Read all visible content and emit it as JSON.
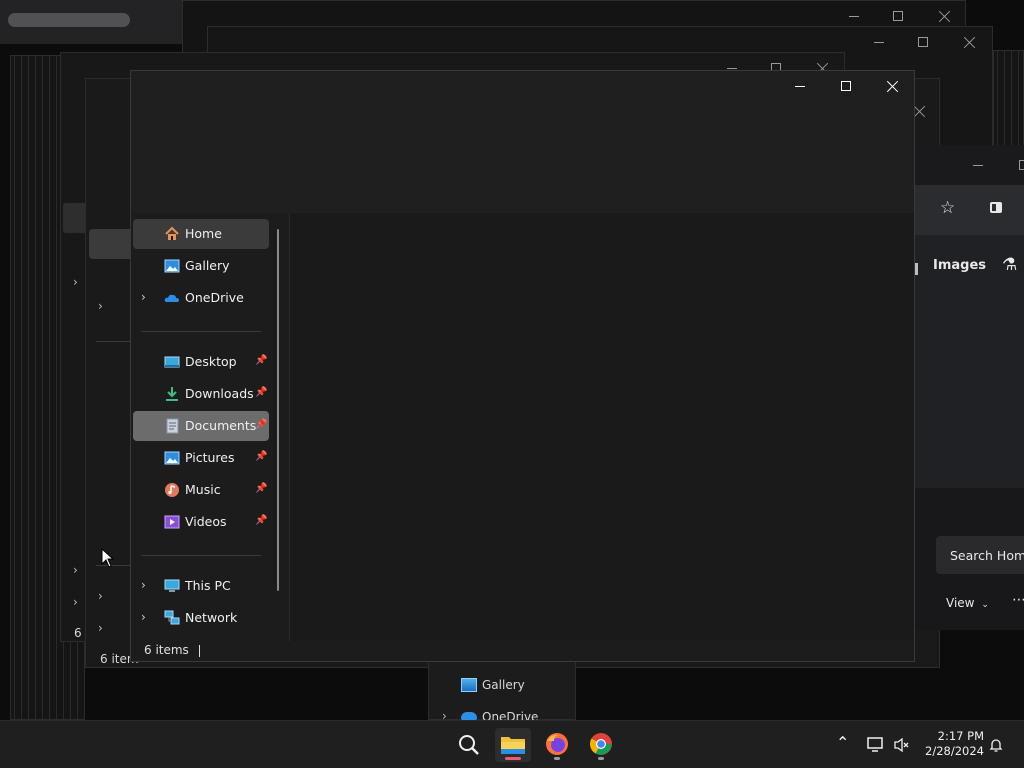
{
  "main_window": {
    "status": "6 items",
    "nav": {
      "quick": [
        {
          "label": "Home",
          "icon": "home-icon",
          "chevron": false
        },
        {
          "label": "Gallery",
          "icon": "gallery-icon",
          "chevron": false
        },
        {
          "label": "OneDrive",
          "icon": "onedrive-icon",
          "chevron": true
        }
      ],
      "pinned": [
        {
          "label": "Desktop",
          "icon": "desktop-icon"
        },
        {
          "label": "Downloads",
          "icon": "downloads-icon"
        },
        {
          "label": "Documents",
          "icon": "documents-icon"
        },
        {
          "label": "Pictures",
          "icon": "pictures-icon"
        },
        {
          "label": "Music",
          "icon": "music-icon"
        },
        {
          "label": "Videos",
          "icon": "videos-icon"
        }
      ],
      "devices": [
        {
          "label": "This PC",
          "icon": "this-pc-icon"
        },
        {
          "label": "Network",
          "icon": "network-icon"
        }
      ]
    }
  },
  "background": {
    "back_window_status": "6 i",
    "back_window_status_2": "6 item",
    "lower_nav": {
      "gallery": "Gallery",
      "onedrive": "OneDrive"
    }
  },
  "browser": {
    "images_label": "Images",
    "search_label": "Search Hom",
    "view_label": "View"
  },
  "taskbar": {
    "time": "2:17 PM",
    "date": "2/28/2024"
  },
  "colors": {
    "accent_taskbar_indicator": "#e85d75",
    "folder_yellow": "#f0c040",
    "onedrive_blue": "#2b8fe8"
  }
}
